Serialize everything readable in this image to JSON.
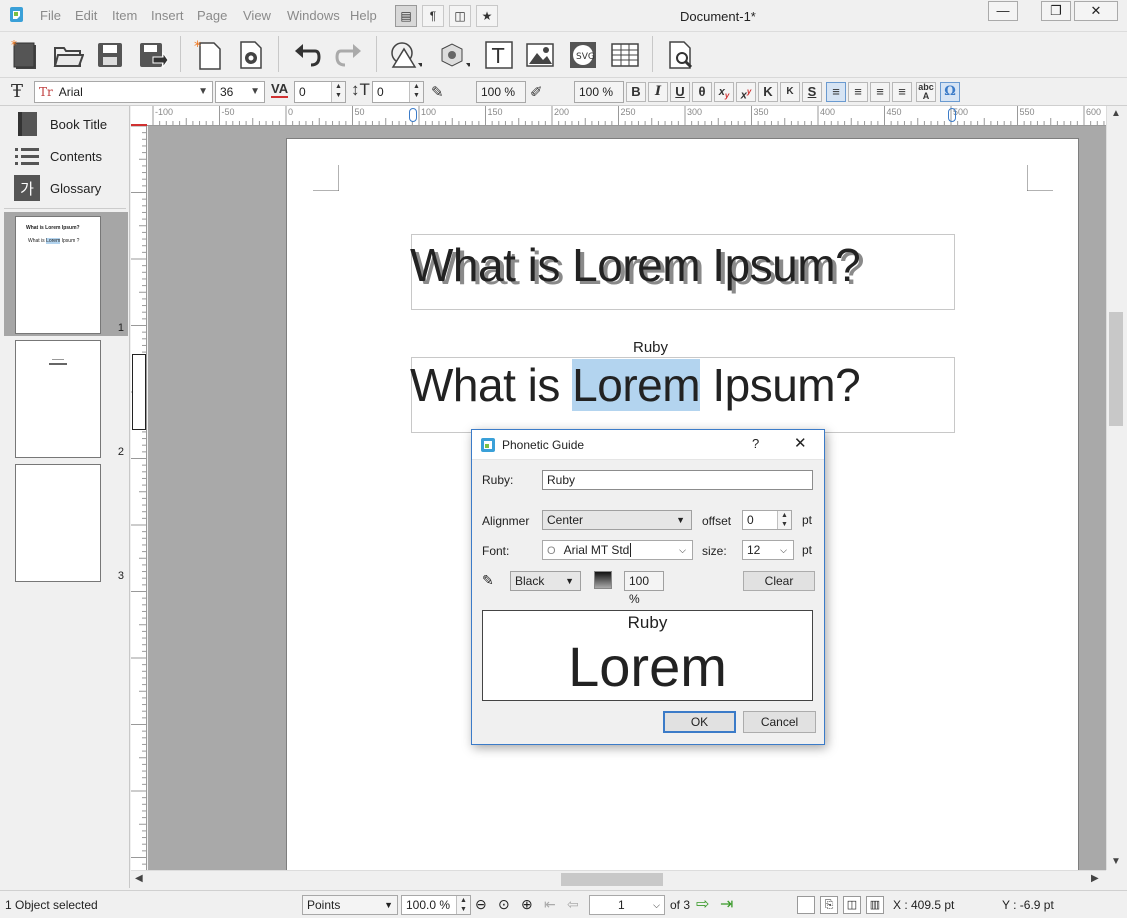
{
  "menu": [
    "File",
    "Edit",
    "Item",
    "Insert",
    "Page",
    "View",
    "Windows",
    "Help"
  ],
  "window": {
    "title": "Document-1*"
  },
  "toolbar2": {
    "font_name": "Arial",
    "font_size": "36",
    "tracking": "0",
    "baseline": "0",
    "fill_opacity": "100 %",
    "stroke_opacity": "100 %",
    "italic_label": "I",
    "bold_label": "B",
    "underline_label": "U",
    "k1": "K",
    "k2": "K"
  },
  "sidebar": {
    "nav": [
      {
        "label": "Book Title"
      },
      {
        "label": "Contents"
      },
      {
        "label": "Glossary"
      }
    ],
    "glossary_glyph": "가",
    "pages": [
      {
        "num": "1",
        "line1": "What is Lorem Ipsum?",
        "line2a": "What is ",
        "line2b": "Lorem",
        "line2c": " Ipsum ?"
      },
      {
        "num": "2",
        "line1": "",
        "line2a": "",
        "line2b": "",
        "line2c": ""
      },
      {
        "num": "3",
        "line1": "",
        "line2a": "",
        "line2b": "",
        "line2c": ""
      }
    ]
  },
  "ruler": {
    "h_ticks": [
      "-100",
      "-50",
      "0",
      "50",
      "100",
      "150",
      "200",
      "250",
      "300",
      "350",
      "400",
      "450",
      "500",
      "550",
      "600"
    ],
    "v_ticks": [
      "0",
      "5",
      "1",
      "1",
      "0",
      "5",
      "2",
      "2",
      "3",
      "3",
      "3",
      "4",
      "4",
      "5",
      "5"
    ]
  },
  "document": {
    "heading1": "What is Lorem Ipsum?",
    "ruby_label": "Ruby",
    "line2_before": "What is ",
    "line2_selected": "Lorem",
    "line2_after": " Ipsum?"
  },
  "dialog": {
    "title": "Phonetic Guide",
    "help": "?",
    "ruby_label": "Ruby:",
    "ruby_value": "Ruby",
    "align_label": "Alignmer",
    "align_value": "Center",
    "offset_label": "offset",
    "offset_value": "0",
    "offset_unit": "pt",
    "font_label": "Font:",
    "font_value": "Arial MT Std",
    "size_label": "size:",
    "size_value": "12",
    "size_unit": "pt",
    "color_value": "Black",
    "opacity_value": "100 %",
    "clear_label": "Clear",
    "preview_ruby": "Ruby",
    "preview_base": "Lorem",
    "ok_label": "OK",
    "cancel_label": "Cancel"
  },
  "status": {
    "selection": "1 Object selected",
    "units": "Points",
    "zoom": "100.0 %",
    "page": "1",
    "of_pages": "of 3",
    "x_coord": "X : 409.5 pt",
    "y_coord": "Y : -6.9 pt"
  },
  "colors": {
    "accent": "#3b7bc8",
    "selection": "#b3d4ef",
    "orange": "#f07820"
  }
}
